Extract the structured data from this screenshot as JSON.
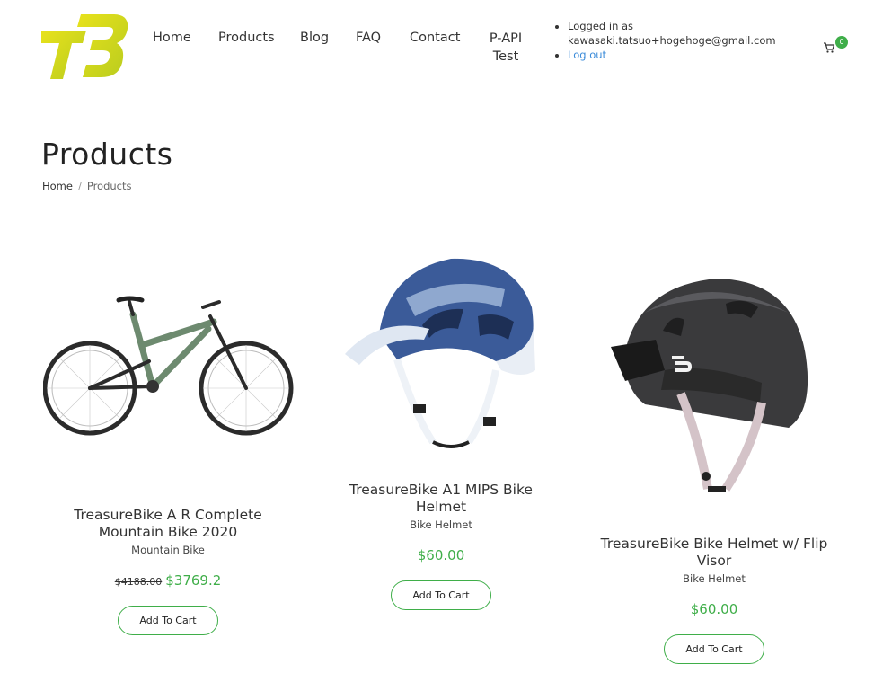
{
  "header": {
    "nav": [
      {
        "label": "Home"
      },
      {
        "label": "Products"
      },
      {
        "label": "Blog"
      },
      {
        "label": "FAQ"
      },
      {
        "label": "Contact"
      },
      {
        "label": "P-API Test"
      }
    ],
    "account": {
      "logged_in_label": "Logged in as",
      "email": "kawasaki.tatsuo+hogehoge@gmail.com",
      "logout_label": "Log out"
    },
    "cart_count": "0"
  },
  "page": {
    "title": "Products",
    "breadcrumb": {
      "home": "Home",
      "separator": "/",
      "current": "Products"
    }
  },
  "products": [
    {
      "name": "TreasureBike A R Complete Mountain Bike 2020",
      "category": "Mountain Bike",
      "old_price": "$4188.00",
      "price": "$3769.2",
      "button": "Add To Cart"
    },
    {
      "name": "TreasureBike A1 MIPS Bike Helmet",
      "category": "Bike Helmet",
      "old_price": "",
      "price": "$60.00",
      "button": "Add To Cart"
    },
    {
      "name": "TreasureBike Bike Helmet w/ Flip Visor",
      "category": "Bike Helmet",
      "old_price": "",
      "price": "$60.00",
      "button": "Add To Cart"
    }
  ],
  "colors": {
    "accent_green": "#3fae49",
    "link_blue": "#3b8bd9",
    "logo_yellow": "#d6dc1e"
  }
}
